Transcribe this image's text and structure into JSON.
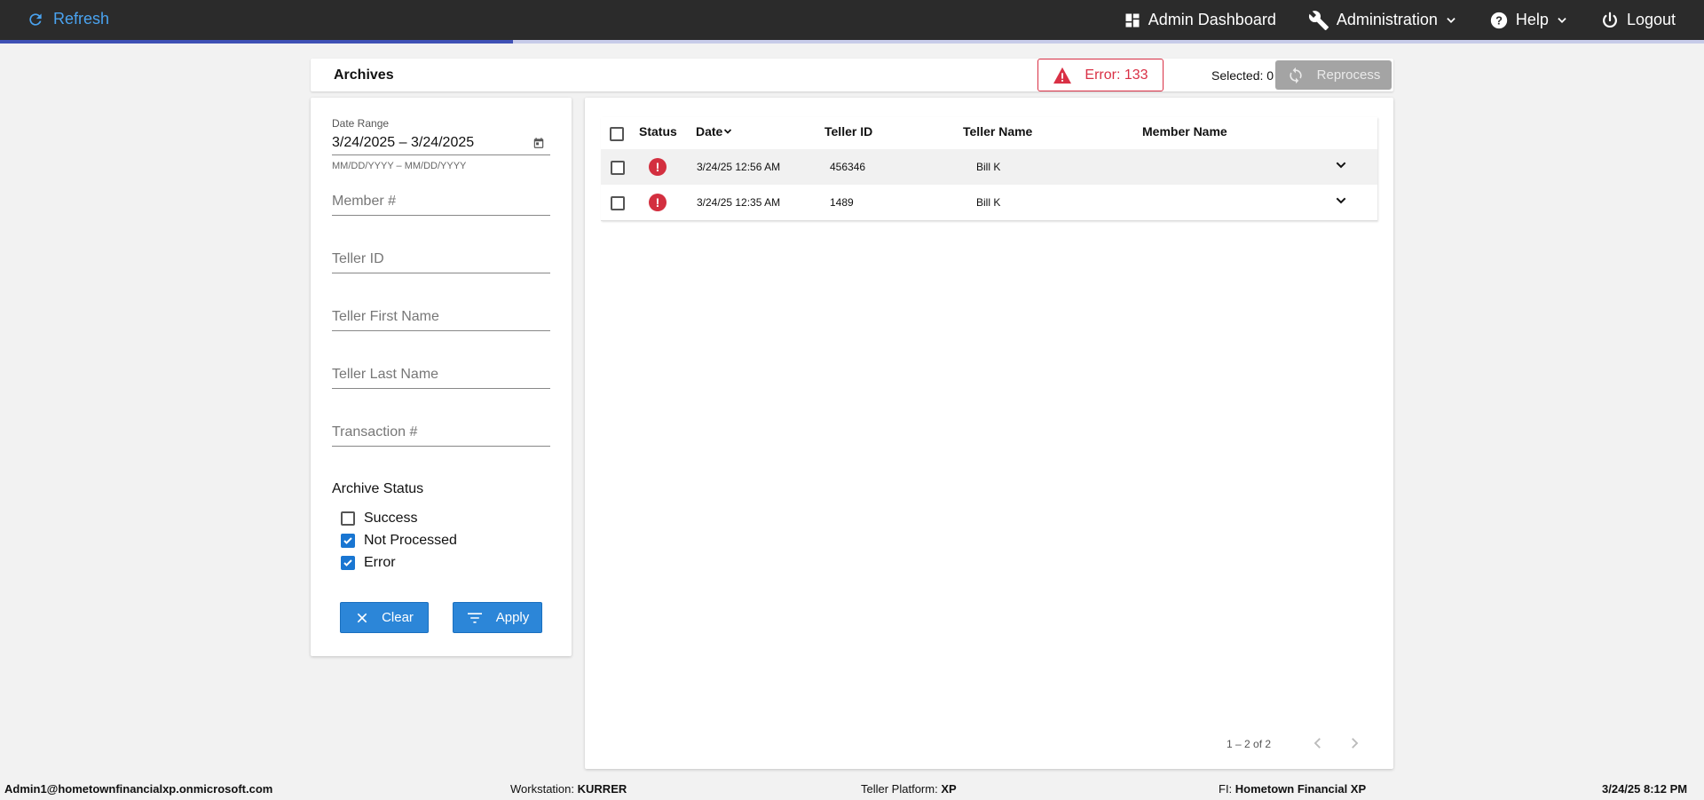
{
  "topbar": {
    "refresh_label": "Refresh",
    "progress_fraction": 0.301,
    "nav": [
      {
        "label": "Admin Dashboard",
        "icon": "dashboard-icon"
      },
      {
        "label": "Administration",
        "icon": "wrench-icon"
      },
      {
        "label": "Help",
        "icon": "help-icon"
      },
      {
        "label": "Logout",
        "icon": "power-icon"
      }
    ]
  },
  "header": {
    "title": "Archives",
    "error_chip": "Error: 133",
    "selected": "Selected: 0",
    "reprocess_label": "Reprocess"
  },
  "filters": {
    "date_range_label": "Date Range",
    "date_range_value": "3/24/2025 – 3/24/2025",
    "date_hint": "MM/DD/YYYY – MM/DD/YYYY",
    "member_placeholder": "Member #",
    "teller_id_placeholder": "Teller ID",
    "teller_first_placeholder": "Teller First Name",
    "teller_last_placeholder": "Teller Last Name",
    "transaction_placeholder": "Transaction #",
    "archive_status_title": "Archive Status",
    "statuses": [
      {
        "label": "Success",
        "checked": false
      },
      {
        "label": "Not Processed",
        "checked": true
      },
      {
        "label": "Error",
        "checked": true
      }
    ],
    "clear_label": "Clear",
    "apply_label": "Apply"
  },
  "table": {
    "columns": [
      "Status",
      "Date",
      "Teller ID",
      "Teller Name",
      "Member Name"
    ],
    "rows": [
      {
        "status": "error",
        "date": "3/24/25 12:56 AM",
        "teller_id": "456346",
        "teller_name": "Bill K",
        "member_name": ""
      },
      {
        "status": "error",
        "date": "3/24/25 12:35 AM",
        "teller_id": "1489",
        "teller_name": "Bill K",
        "member_name": ""
      }
    ],
    "paginator": "1 – 2 of 2"
  },
  "footer": {
    "user": "Admin1@hometownfinancialxp.onmicrosoft.com",
    "workstation_label": "Workstation:",
    "workstation_value": "KURRER",
    "platform_label": "Teller Platform:",
    "platform_value": "XP",
    "fi_label": "FI:",
    "fi_value": "Hometown Financial XP",
    "datetime": "3/24/25 8:12 PM"
  },
  "colors": {
    "topbar": "#2b2b2b",
    "accent_blue": "#2c86d8",
    "error_red": "#d93045"
  }
}
